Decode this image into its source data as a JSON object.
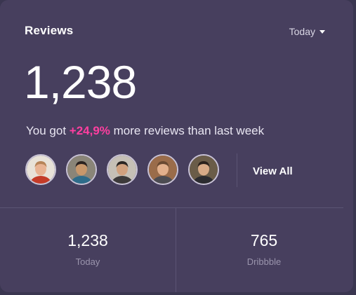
{
  "header": {
    "title": "Reviews",
    "period": "Today"
  },
  "summary": {
    "count": "1,238",
    "text_before": "You got ",
    "highlight": "+24,9%",
    "text_after": " more reviews than last week",
    "highlight_color": "#ff3fa0"
  },
  "reviewers": {
    "avatars": [
      {
        "icon": "person-avatar-icon",
        "bg": "#e8e2d8",
        "skin": "#e8b393",
        "hair": "#b68458",
        "shirt": "#c43b28"
      },
      {
        "icon": "person-avatar-icon",
        "bg": "#8a8578",
        "skin": "#c7976b",
        "hair": "#2a2220",
        "shirt": "#2e6c8a"
      },
      {
        "icon": "person-avatar-icon",
        "bg": "#c6c0b6",
        "skin": "#d1a17e",
        "hair": "#2b2623",
        "shirt": "#3d3a3a"
      },
      {
        "icon": "person-avatar-icon",
        "bg": "#9a6c4a",
        "skin": "#e2b08c",
        "hair": "#6a4a32",
        "shirt": "#4c4c52"
      },
      {
        "icon": "person-avatar-icon",
        "bg": "#6a5c48",
        "skin": "#d8ab88",
        "hair": "#2a211c",
        "shirt": "#2c2c30"
      }
    ],
    "view_all_label": "View All"
  },
  "stats": [
    {
      "value": "1,238",
      "label": "Today"
    },
    {
      "value": "765",
      "label": "Dribbble"
    }
  ],
  "colors": {
    "card_bg": "#473f5e",
    "divider": "#5b5474",
    "muted_text": "#9b95ad"
  }
}
